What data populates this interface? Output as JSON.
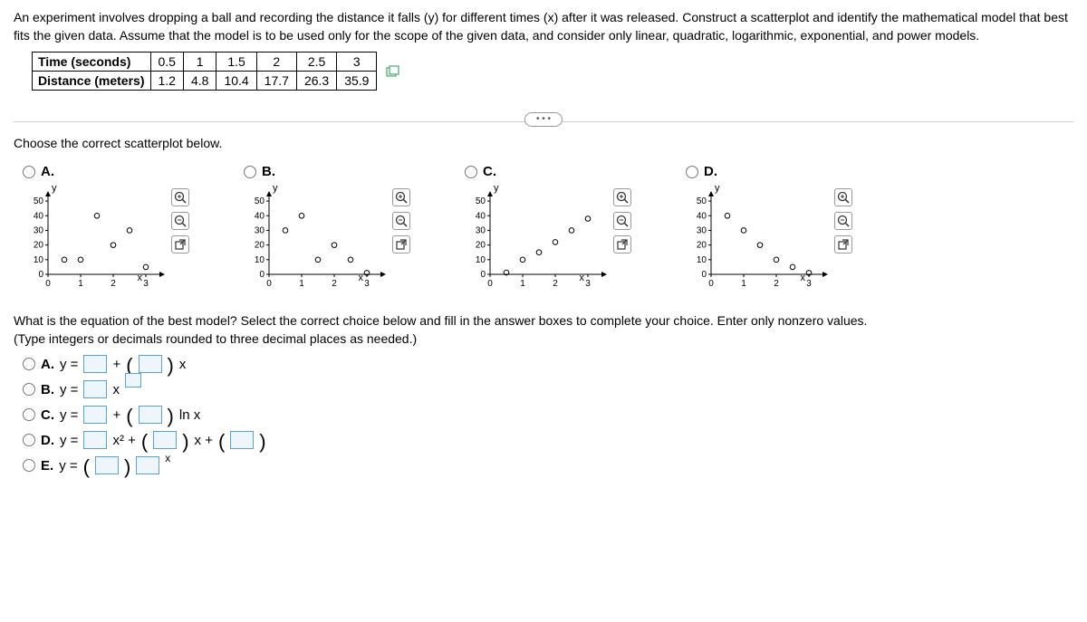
{
  "problem": "An experiment involves dropping a ball and recording the distance it falls (y) for different times (x) after it was released. Construct a scatterplot and identify the mathematical model that best fits the given data. Assume that the model is to be used only for the scope of the given data, and consider only linear, quadratic, logarithmic, exponential, and power models.",
  "table": {
    "row1_label": "Time (seconds)",
    "row2_label": "Distance (meters)",
    "cols": [
      "0.5",
      "1",
      "1.5",
      "2",
      "2.5",
      "3"
    ],
    "vals": [
      "1.2",
      "4.8",
      "10.4",
      "17.7",
      "26.3",
      "35.9"
    ]
  },
  "q1": "Choose the correct scatterplot below.",
  "plot_labels": {
    "a": "A.",
    "b": "B.",
    "c": "C.",
    "d": "D."
  },
  "axis": {
    "y": "y",
    "x": "x"
  },
  "chart_data": [
    {
      "id": "A",
      "type": "scatter",
      "xlim": [
        0,
        3.5
      ],
      "ylim": [
        0,
        55
      ],
      "xticks": [
        0,
        1,
        2,
        3
      ],
      "yticks": [
        0,
        10,
        20,
        30,
        40,
        50
      ],
      "points": [
        [
          0.5,
          10
        ],
        [
          1,
          10
        ],
        [
          1.5,
          40
        ],
        [
          2,
          20
        ],
        [
          2.5,
          30
        ],
        [
          3,
          5
        ]
      ]
    },
    {
      "id": "B",
      "type": "scatter",
      "xlim": [
        0,
        3.5
      ],
      "ylim": [
        0,
        55
      ],
      "xticks": [
        0,
        1,
        2,
        3
      ],
      "yticks": [
        0,
        10,
        20,
        30,
        40,
        50
      ],
      "points": [
        [
          0.5,
          30
        ],
        [
          1,
          40
        ],
        [
          1.5,
          10
        ],
        [
          2,
          20
        ],
        [
          2.5,
          10
        ],
        [
          3,
          1
        ]
      ]
    },
    {
      "id": "C",
      "type": "scatter",
      "xlim": [
        0,
        3.5
      ],
      "ylim": [
        0,
        55
      ],
      "xticks": [
        0,
        1,
        2,
        3
      ],
      "yticks": [
        0,
        10,
        20,
        30,
        40,
        50
      ],
      "points": [
        [
          0.5,
          1.2
        ],
        [
          1,
          10
        ],
        [
          1.5,
          15
        ],
        [
          2,
          22
        ],
        [
          2.5,
          30
        ],
        [
          3,
          38
        ]
      ]
    },
    {
      "id": "D",
      "type": "scatter",
      "xlim": [
        0,
        3.5
      ],
      "ylim": [
        0,
        55
      ],
      "xticks": [
        0,
        1,
        2,
        3
      ],
      "yticks": [
        0,
        10,
        20,
        30,
        40,
        50
      ],
      "points": [
        [
          0.5,
          40
        ],
        [
          1,
          30
        ],
        [
          1.5,
          20
        ],
        [
          2,
          10
        ],
        [
          2.5,
          5
        ],
        [
          3,
          1
        ]
      ]
    }
  ],
  "q2": "What is the equation of the best model? Select the correct choice below and fill in the answer boxes to complete your choice. Enter only nonzero values.",
  "q2_instr": "(Type integers or decimals rounded to three decimal places as needed.)",
  "answers": {
    "a_label": "A.",
    "a_prefix": "y =",
    "a_mid": " + ",
    "a_suffix": " x",
    "b_label": "B.",
    "b_prefix": "y = ",
    "b_mid": "x",
    "c_label": "C.",
    "c_prefix": "y = ",
    "c_mid": " + ",
    "c_suffix": " ln x",
    "d_label": "D.",
    "d_prefix": "y = ",
    "d_x2": "x² + ",
    "d_xplus": " x + ",
    "e_label": "E.",
    "e_prefix": "y = "
  }
}
